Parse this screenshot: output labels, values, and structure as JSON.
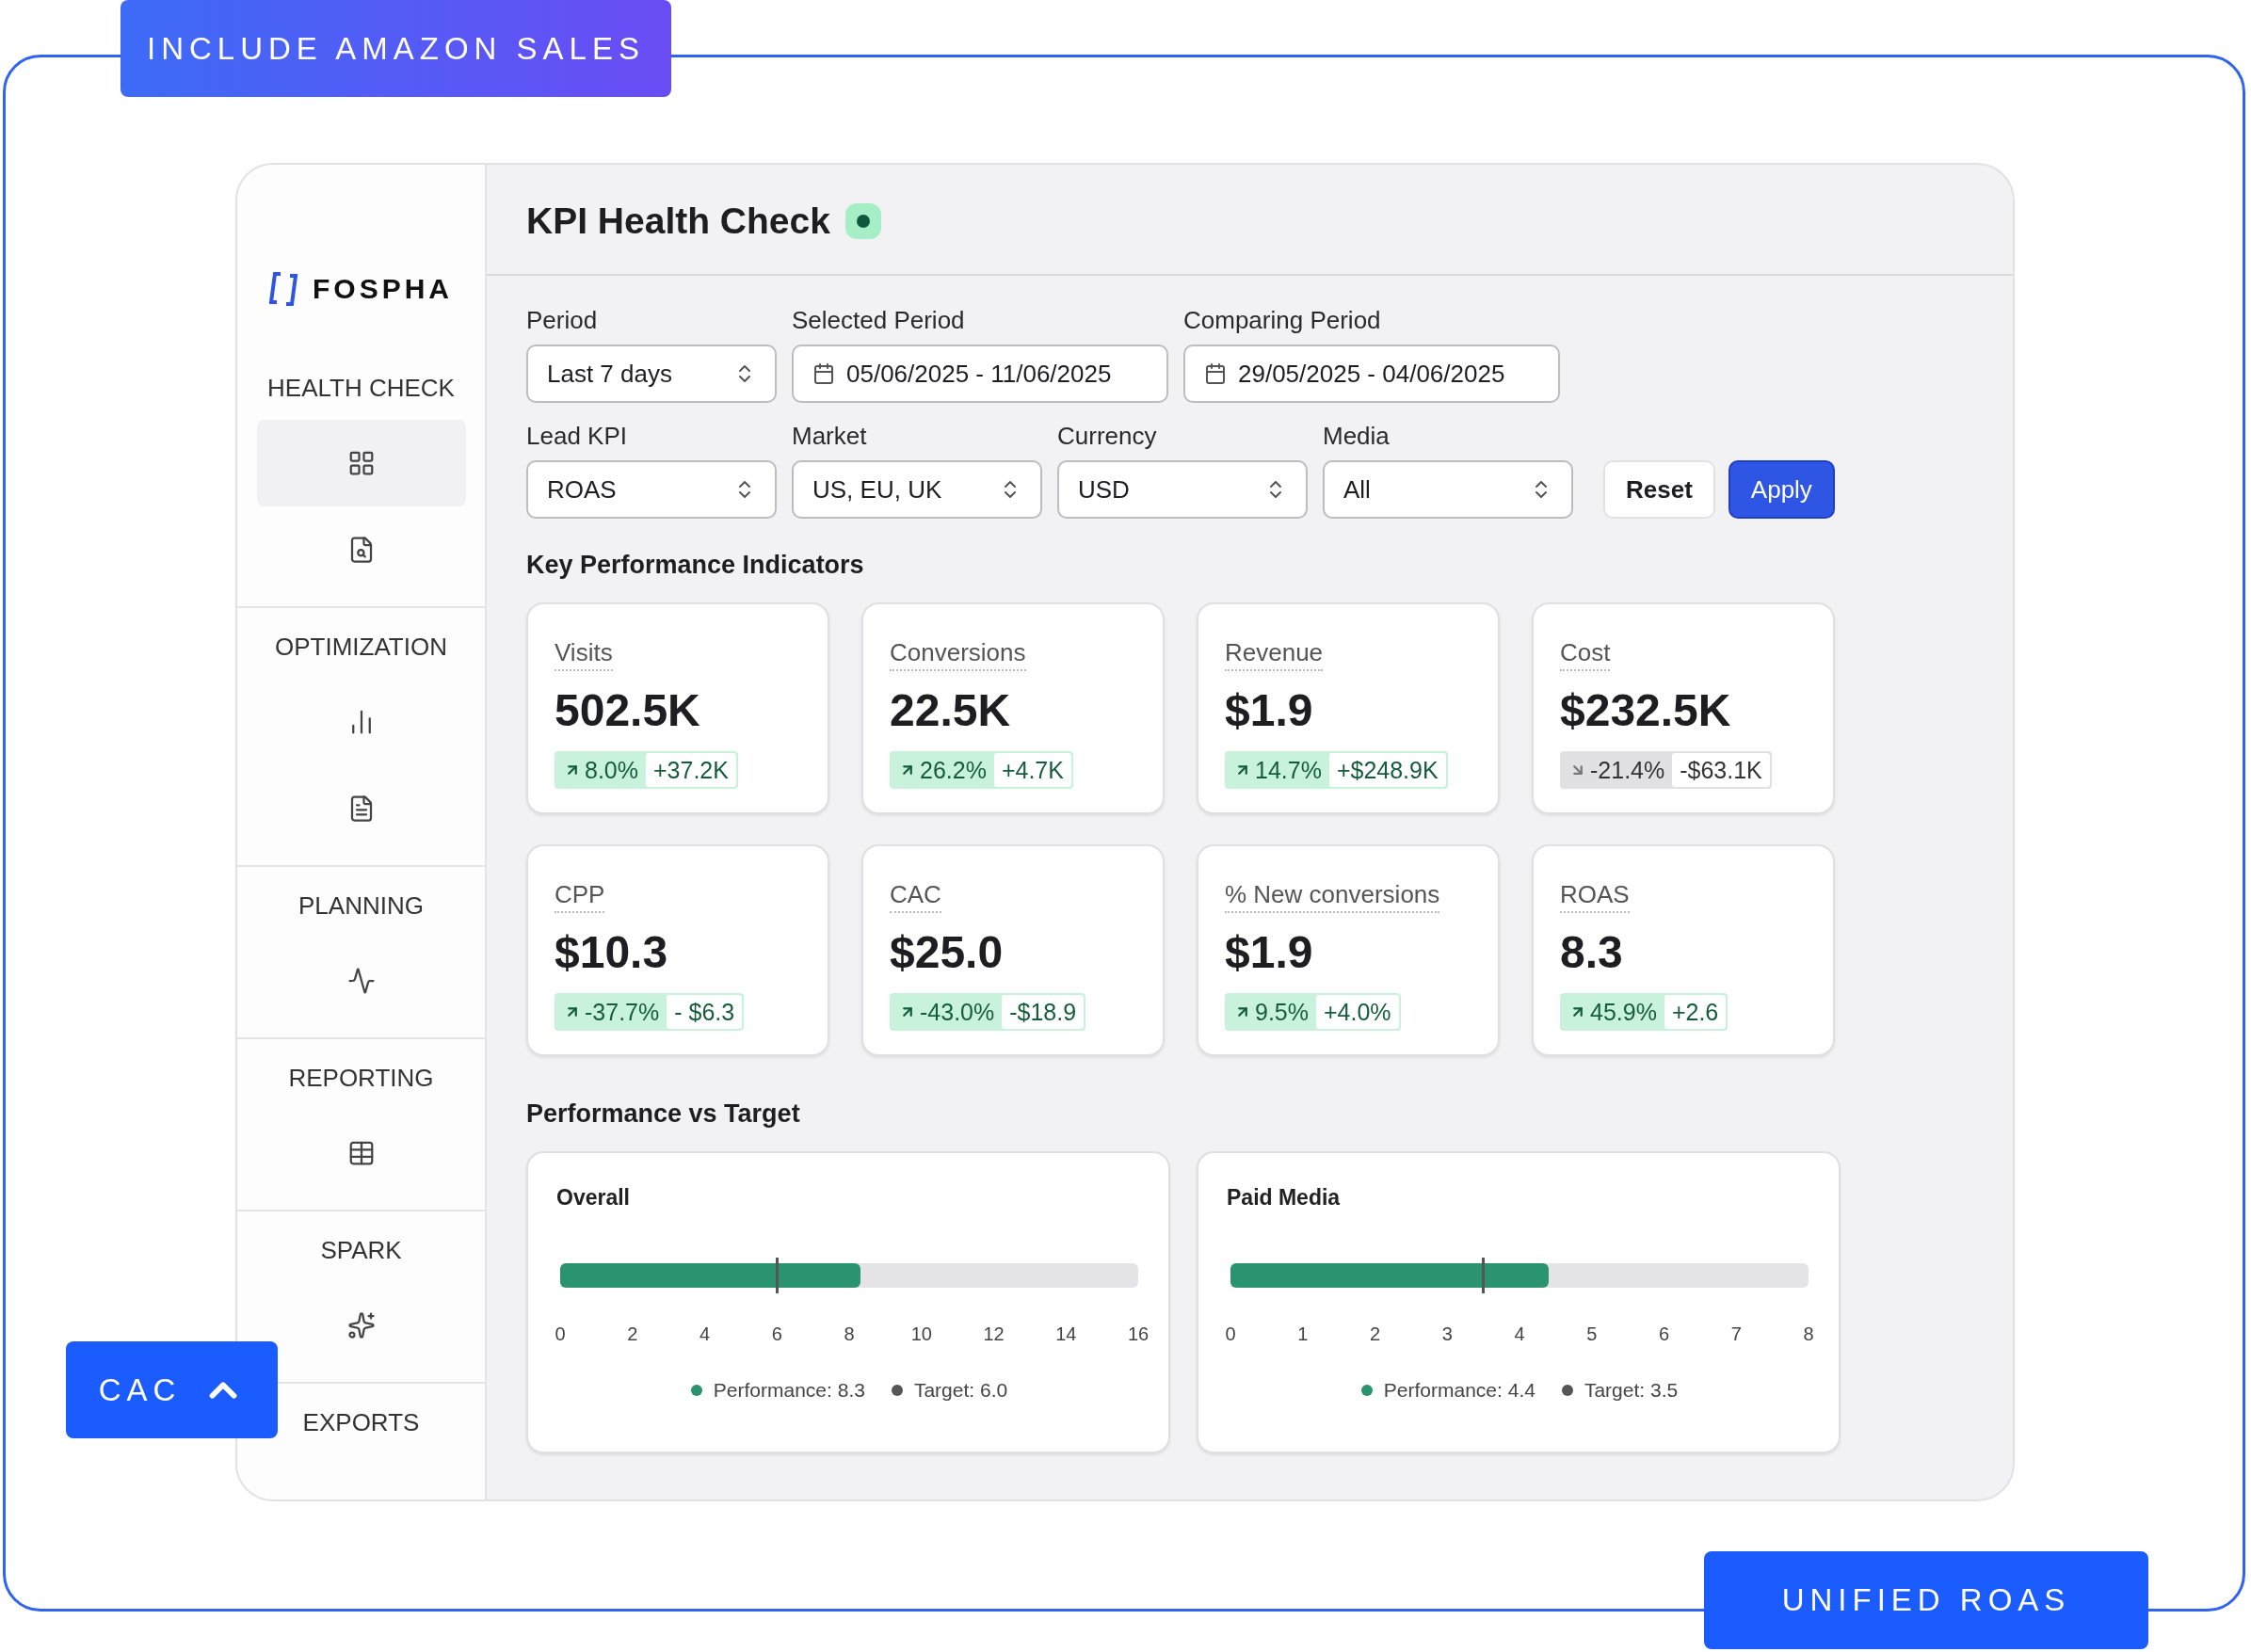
{
  "top_tag": {
    "label": "INCLUDE AMAZON SALES"
  },
  "side_tag": {
    "label": "CAC"
  },
  "bottom_tag": {
    "label": "UNIFIED ROAS"
  },
  "logo": {
    "text": "FOSPHA"
  },
  "sidebar": {
    "sections": [
      {
        "label": "HEALTH CHECK",
        "items": [
          {
            "selected": true
          },
          {
            "selected": false
          }
        ]
      },
      {
        "label": "OPTIMIZATION",
        "items": [
          {
            "selected": false
          },
          {
            "selected": false
          }
        ]
      },
      {
        "label": "PLANNING",
        "items": [
          {
            "selected": false
          }
        ]
      },
      {
        "label": "REPORTING",
        "items": [
          {
            "selected": false
          }
        ]
      },
      {
        "label": "SPARK",
        "items": [
          {
            "selected": false
          }
        ]
      },
      {
        "label": "EXPORTS"
      }
    ]
  },
  "header": {
    "title": "KPI Health Check"
  },
  "filters": {
    "date_filters": [
      {
        "label": "Period",
        "value": "Last 7 days",
        "kind": "select"
      },
      {
        "label": "Selected Period",
        "value": "05/06/2025 - 11/06/2025",
        "kind": "date"
      },
      {
        "label": "Comparing Period",
        "value": "29/05/2025 - 04/06/2025",
        "kind": "date"
      }
    ],
    "scope_filters": [
      {
        "label": "Lead KPI",
        "value": "ROAS",
        "kind": "select"
      },
      {
        "label": "Market",
        "value": "US, EU, UK",
        "kind": "select"
      },
      {
        "label": "Currency",
        "value": "USD",
        "kind": "select"
      },
      {
        "label": "Media",
        "value": "All",
        "kind": "select"
      }
    ],
    "buttons": [
      {
        "label": "Reset",
        "kind": "secondary"
      },
      {
        "label": "Apply",
        "kind": "primary"
      }
    ]
  },
  "kpi_section": {
    "title": "Key Performance Indicators",
    "cards": [
      {
        "label": "Visits",
        "value": "502.5K",
        "change": "8.0%",
        "delta": "+37.2K",
        "kind": "up"
      },
      {
        "label": "Conversions",
        "value": "22.5K",
        "change": "26.2%",
        "delta": "+4.7K",
        "kind": "up"
      },
      {
        "label": "Revenue",
        "value": "$1.9",
        "change": "14.7%",
        "delta": "+$248.9K",
        "kind": "up"
      },
      {
        "label": "Cost",
        "value": "$232.5K",
        "change": "-21.4%",
        "delta": "-$63.1K",
        "kind": "down"
      },
      {
        "label": "CPP",
        "value": "$10.3",
        "change": "-37.7%",
        "delta": "- $6.3",
        "kind": "up"
      },
      {
        "label": "CAC",
        "value": "$25.0",
        "change": "-43.0%",
        "delta": "-$18.9",
        "kind": "up"
      },
      {
        "label": "% New conversions",
        "value": "$1.9",
        "change": "9.5%",
        "delta": "+4.0%",
        "kind": "up"
      },
      {
        "label": "ROAS",
        "value": "8.3",
        "change": "45.9%",
        "delta": "+2.6",
        "kind": "up"
      }
    ]
  },
  "target_section": {
    "title": "Performance vs Target",
    "panels": [
      {
        "title": "Overall",
        "performance": {
          "level": 0.519
        },
        "target": {
          "level": 0.375
        },
        "ticks": [
          "0",
          "2",
          "4",
          "6",
          "8",
          "10",
          "12",
          "14",
          "16"
        ],
        "legend": [
          "Performance: 8.3",
          "Target: 6.0"
        ]
      },
      {
        "title": "Paid Media",
        "performance": {
          "level": 0.55
        },
        "target": {
          "level": 0.4375
        },
        "ticks": [
          "0",
          "1",
          "2",
          "3",
          "4",
          "5",
          "6",
          "7",
          "8"
        ],
        "legend": [
          "Performance: 4.4",
          "Target: 3.5"
        ]
      }
    ]
  }
}
